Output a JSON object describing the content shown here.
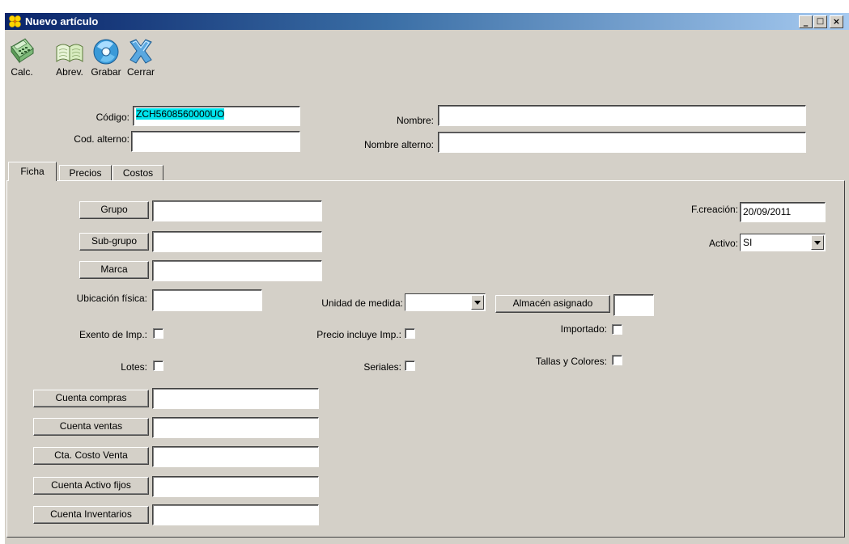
{
  "window": {
    "title": "Nuevo artículo",
    "min": "_",
    "max": "□",
    "close": "×"
  },
  "toolbar": [
    {
      "label": "Calc.",
      "icon": "calculator-icon"
    },
    {
      "label": "Abrev.",
      "icon": "book-icon"
    },
    {
      "label": "Grabar",
      "icon": "save-disc-icon"
    },
    {
      "label": "Cerrar",
      "icon": "close-x-icon"
    }
  ],
  "header": {
    "codigo_label": "Código:",
    "codigo_value": "ZCH5608560000UO",
    "cod_alterno_label": "Cod. alterno:",
    "cod_alterno_value": "",
    "nombre_label": "Nombre:",
    "nombre_value": "",
    "nombre_alterno_label": "Nombre alterno:",
    "nombre_alterno_value": ""
  },
  "tabs": [
    "Ficha",
    "Precios",
    "Costos"
  ],
  "ficha": {
    "grupo": "Grupo",
    "subgrupo": "Sub-grupo",
    "marca": "Marca",
    "ubicacion_label": "Ubicación física:",
    "unidad_label": "Unidad de medida:",
    "unidad_value": "",
    "almacen_btn": "Almacén asignado",
    "fcreacion_label": "F.creación:",
    "fcreacion_value": "20/09/2011",
    "activo_label": "Activo:",
    "activo_value": "SI",
    "exento_label": "Exento de Imp.:",
    "precio_incluye_label": "Precio incluye Imp.:",
    "importado_label": "Importado:",
    "lotes_label": "Lotes:",
    "seriales_label": "Seriales:",
    "tallas_label": "Tallas y Colores:",
    "cuenta_compras": "Cuenta compras",
    "cuenta_ventas": "Cuenta ventas",
    "cta_costo_venta": "Cta. Costo Venta",
    "cuenta_activo_fijos": "Cuenta Activo fijos",
    "cuenta_inventarios": "Cuenta Inventarios"
  },
  "colors": {
    "highlight": "#00e5ee",
    "face": "#d4d0c8"
  }
}
